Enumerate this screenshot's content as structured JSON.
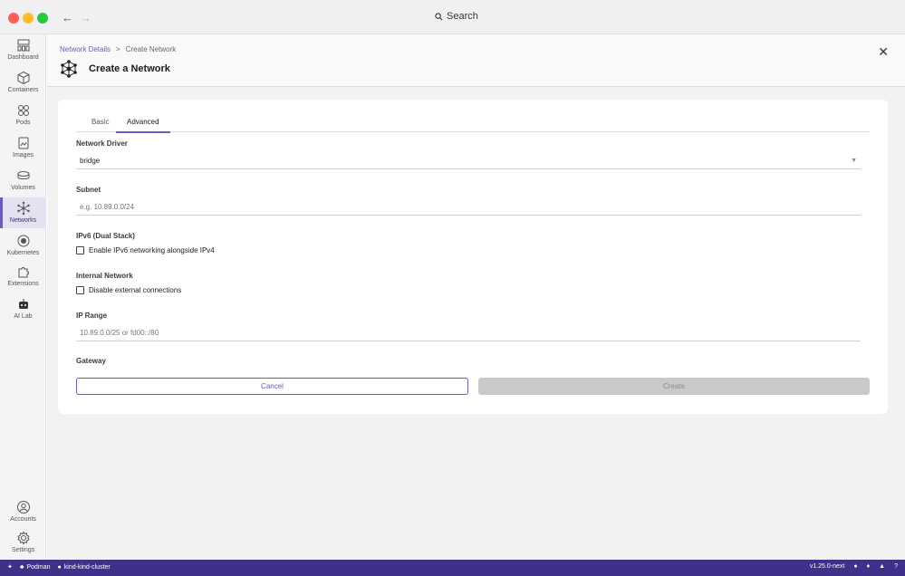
{
  "titlebar": {
    "search_label": "Search"
  },
  "sidebar": {
    "items": [
      {
        "label": "Dashboard",
        "icon": "dashboard-icon"
      },
      {
        "label": "Containers",
        "icon": "container-icon"
      },
      {
        "label": "Pods",
        "icon": "pods-icon"
      },
      {
        "label": "Images",
        "icon": "image-icon"
      },
      {
        "label": "Volumes",
        "icon": "volume-icon"
      },
      {
        "label": "Networks",
        "icon": "network-icon",
        "active": true
      },
      {
        "label": "Kubernetes",
        "icon": "kubernetes-icon"
      },
      {
        "label": "Extensions",
        "icon": "puzzle-icon"
      },
      {
        "label": "AI Lab",
        "icon": "robot-icon"
      }
    ],
    "bottom": [
      {
        "label": "Accounts",
        "icon": "account-icon"
      },
      {
        "label": "Settings",
        "icon": "gear-icon"
      }
    ]
  },
  "header": {
    "breadcrumb": {
      "parent": "Network Details",
      "separator": ">",
      "current": "Create Network"
    },
    "title": "Create a Network"
  },
  "form": {
    "tabs": [
      {
        "label": "Basic"
      },
      {
        "label": "Advanced",
        "active": true
      }
    ],
    "network_driver": {
      "label": "Network Driver",
      "value": "bridge"
    },
    "subnet": {
      "label": "Subnet",
      "placeholder": "e.g. 10.89.0.0/24"
    },
    "ipv6": {
      "label": "IPv6 (Dual Stack)",
      "checkbox_label": "Enable IPv6 networking alongside IPv4"
    },
    "internal": {
      "label": "Internal Network",
      "checkbox_label": "Disable external connections"
    },
    "ip_range": {
      "label": "IP Range",
      "placeholder": "10.89.0.0/25 or fd00::/80"
    },
    "gateway": {
      "label": "Gateway"
    },
    "cancel_label": "Cancel",
    "create_label": "Create"
  },
  "statusbar": {
    "engine": "Podman",
    "cluster": "kind-kind-cluster",
    "version": "v1.25.0-next"
  },
  "colors": {
    "accent": "#6c5bb8",
    "statusbar": "#3f3089"
  }
}
